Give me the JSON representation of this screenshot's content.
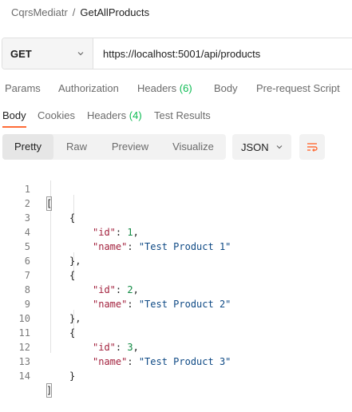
{
  "breadcrumb": {
    "parent": "CqrsMediatr",
    "separator": "/",
    "current": "GetAllProducts"
  },
  "request": {
    "method": "GET",
    "url": "https://localhost:5001/api/products"
  },
  "request_tabs": {
    "params": "Params",
    "authorization": "Authorization",
    "headers": "Headers",
    "headers_count": "(6)",
    "body": "Body",
    "prerequest": "Pre-request Script"
  },
  "response_tabs": {
    "body": "Body",
    "cookies": "Cookies",
    "headers": "Headers",
    "headers_count": "(4)",
    "test_results": "Test Results"
  },
  "format": {
    "pretty": "Pretty",
    "raw": "Raw",
    "preview": "Preview",
    "visualize": "Visualize",
    "language": "JSON",
    "wrap_icon": "wrap-lines-icon",
    "accent": "#ff6c37"
  },
  "code": {
    "line_numbers": [
      "1",
      "2",
      "3",
      "4",
      "5",
      "6",
      "7",
      "8",
      "9",
      "10",
      "11",
      "12",
      "13",
      "14"
    ],
    "open_array": "[",
    "close_array": "]",
    "open_obj": "{",
    "close_obj": "},",
    "close_obj_last": "}",
    "id_key": "\"id\"",
    "name_key": "\"name\"",
    "colon": ": ",
    "comma": ",",
    "items": [
      {
        "id": "1",
        "name": "\"Test Product 1\""
      },
      {
        "id": "2",
        "name": "\"Test Product 2\""
      },
      {
        "id": "3",
        "name": "\"Test Product 3\""
      }
    ]
  }
}
